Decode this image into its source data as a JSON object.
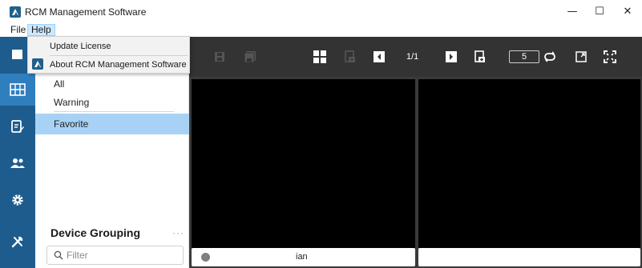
{
  "window": {
    "title": "RCM Management Software",
    "controls": {
      "minimize": "—",
      "maximize": "☐",
      "close": "✕"
    }
  },
  "menubar": {
    "file": "File",
    "help": "Help"
  },
  "help_menu": {
    "items": [
      {
        "label": "Update License"
      },
      {
        "label": "About RCM Management Software"
      }
    ]
  },
  "rail": {
    "items": [
      {
        "icon": "live-view-grid-icon",
        "active": true
      },
      {
        "icon": "edit-notes-icon"
      },
      {
        "icon": "users-icon"
      },
      {
        "icon": "settings-gear-icon"
      },
      {
        "icon": "tools-icon"
      }
    ]
  },
  "panel": {
    "filters": [
      "All",
      "Warning",
      "Favorite"
    ],
    "selected": "Favorite",
    "group_title": "Device Grouping",
    "more": "···",
    "filter_placeholder": "Filter"
  },
  "toolbar": {
    "page": "1/1",
    "count": "5"
  },
  "panes": {
    "left": {
      "device_name": "ian",
      "status_color": "#808080"
    },
    "right": {
      "device_name": ""
    }
  },
  "colors": {
    "rail": "#1e5c8e",
    "rail_active": "#2f7fbf",
    "selected_item": "#a7d2f5",
    "toolbar": "#333333"
  }
}
